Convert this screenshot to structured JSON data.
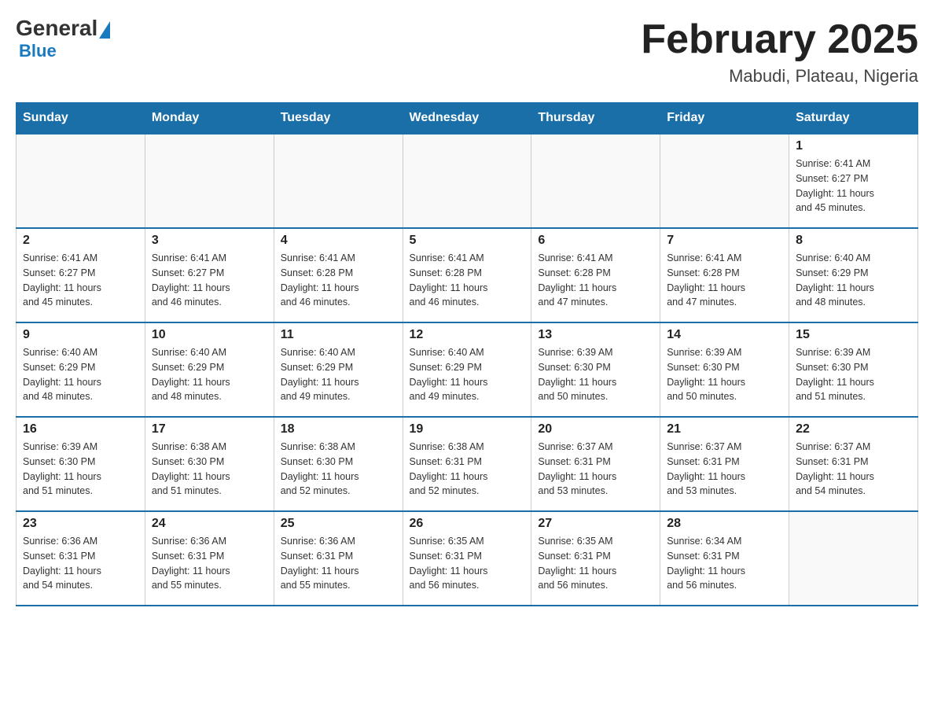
{
  "logo": {
    "general": "General",
    "blue": "Blue"
  },
  "header": {
    "month": "February 2025",
    "location": "Mabudi, Plateau, Nigeria"
  },
  "weekdays": [
    "Sunday",
    "Monday",
    "Tuesday",
    "Wednesday",
    "Thursday",
    "Friday",
    "Saturday"
  ],
  "weeks": [
    [
      {
        "day": "",
        "info": ""
      },
      {
        "day": "",
        "info": ""
      },
      {
        "day": "",
        "info": ""
      },
      {
        "day": "",
        "info": ""
      },
      {
        "day": "",
        "info": ""
      },
      {
        "day": "",
        "info": ""
      },
      {
        "day": "1",
        "info": "Sunrise: 6:41 AM\nSunset: 6:27 PM\nDaylight: 11 hours\nand 45 minutes."
      }
    ],
    [
      {
        "day": "2",
        "info": "Sunrise: 6:41 AM\nSunset: 6:27 PM\nDaylight: 11 hours\nand 45 minutes."
      },
      {
        "day": "3",
        "info": "Sunrise: 6:41 AM\nSunset: 6:27 PM\nDaylight: 11 hours\nand 46 minutes."
      },
      {
        "day": "4",
        "info": "Sunrise: 6:41 AM\nSunset: 6:28 PM\nDaylight: 11 hours\nand 46 minutes."
      },
      {
        "day": "5",
        "info": "Sunrise: 6:41 AM\nSunset: 6:28 PM\nDaylight: 11 hours\nand 46 minutes."
      },
      {
        "day": "6",
        "info": "Sunrise: 6:41 AM\nSunset: 6:28 PM\nDaylight: 11 hours\nand 47 minutes."
      },
      {
        "day": "7",
        "info": "Sunrise: 6:41 AM\nSunset: 6:28 PM\nDaylight: 11 hours\nand 47 minutes."
      },
      {
        "day": "8",
        "info": "Sunrise: 6:40 AM\nSunset: 6:29 PM\nDaylight: 11 hours\nand 48 minutes."
      }
    ],
    [
      {
        "day": "9",
        "info": "Sunrise: 6:40 AM\nSunset: 6:29 PM\nDaylight: 11 hours\nand 48 minutes."
      },
      {
        "day": "10",
        "info": "Sunrise: 6:40 AM\nSunset: 6:29 PM\nDaylight: 11 hours\nand 48 minutes."
      },
      {
        "day": "11",
        "info": "Sunrise: 6:40 AM\nSunset: 6:29 PM\nDaylight: 11 hours\nand 49 minutes."
      },
      {
        "day": "12",
        "info": "Sunrise: 6:40 AM\nSunset: 6:29 PM\nDaylight: 11 hours\nand 49 minutes."
      },
      {
        "day": "13",
        "info": "Sunrise: 6:39 AM\nSunset: 6:30 PM\nDaylight: 11 hours\nand 50 minutes."
      },
      {
        "day": "14",
        "info": "Sunrise: 6:39 AM\nSunset: 6:30 PM\nDaylight: 11 hours\nand 50 minutes."
      },
      {
        "day": "15",
        "info": "Sunrise: 6:39 AM\nSunset: 6:30 PM\nDaylight: 11 hours\nand 51 minutes."
      }
    ],
    [
      {
        "day": "16",
        "info": "Sunrise: 6:39 AM\nSunset: 6:30 PM\nDaylight: 11 hours\nand 51 minutes."
      },
      {
        "day": "17",
        "info": "Sunrise: 6:38 AM\nSunset: 6:30 PM\nDaylight: 11 hours\nand 51 minutes."
      },
      {
        "day": "18",
        "info": "Sunrise: 6:38 AM\nSunset: 6:30 PM\nDaylight: 11 hours\nand 52 minutes."
      },
      {
        "day": "19",
        "info": "Sunrise: 6:38 AM\nSunset: 6:31 PM\nDaylight: 11 hours\nand 52 minutes."
      },
      {
        "day": "20",
        "info": "Sunrise: 6:37 AM\nSunset: 6:31 PM\nDaylight: 11 hours\nand 53 minutes."
      },
      {
        "day": "21",
        "info": "Sunrise: 6:37 AM\nSunset: 6:31 PM\nDaylight: 11 hours\nand 53 minutes."
      },
      {
        "day": "22",
        "info": "Sunrise: 6:37 AM\nSunset: 6:31 PM\nDaylight: 11 hours\nand 54 minutes."
      }
    ],
    [
      {
        "day": "23",
        "info": "Sunrise: 6:36 AM\nSunset: 6:31 PM\nDaylight: 11 hours\nand 54 minutes."
      },
      {
        "day": "24",
        "info": "Sunrise: 6:36 AM\nSunset: 6:31 PM\nDaylight: 11 hours\nand 55 minutes."
      },
      {
        "day": "25",
        "info": "Sunrise: 6:36 AM\nSunset: 6:31 PM\nDaylight: 11 hours\nand 55 minutes."
      },
      {
        "day": "26",
        "info": "Sunrise: 6:35 AM\nSunset: 6:31 PM\nDaylight: 11 hours\nand 56 minutes."
      },
      {
        "day": "27",
        "info": "Sunrise: 6:35 AM\nSunset: 6:31 PM\nDaylight: 11 hours\nand 56 minutes."
      },
      {
        "day": "28",
        "info": "Sunrise: 6:34 AM\nSunset: 6:31 PM\nDaylight: 11 hours\nand 56 minutes."
      },
      {
        "day": "",
        "info": ""
      }
    ]
  ]
}
